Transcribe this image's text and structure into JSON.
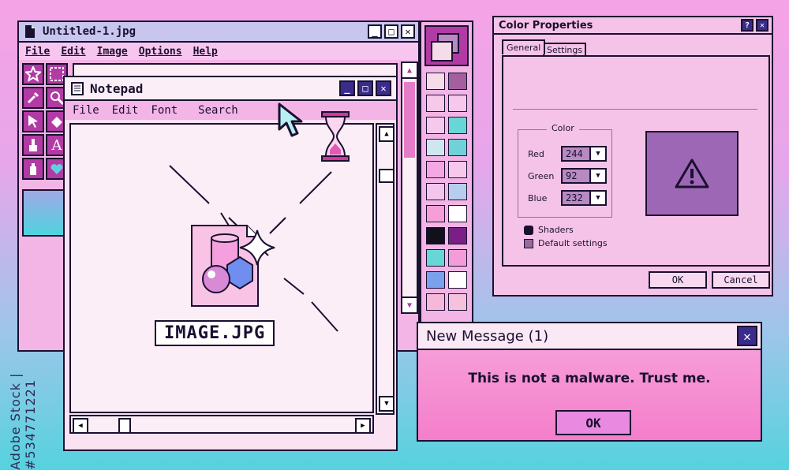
{
  "paint": {
    "title": "Untitled-1.jpg",
    "menu": [
      "File",
      "Edit",
      "Image",
      "Options",
      "Help"
    ]
  },
  "notepad": {
    "title": "Notepad",
    "menu": [
      "File",
      "Edit",
      "Font",
      "Search"
    ],
    "file_label": "IMAGE.JPG"
  },
  "color_properties": {
    "title": "Color Properties",
    "tabs": [
      "General",
      "Settings"
    ],
    "group_label": "Color",
    "red_label": "Red",
    "red_value": "244",
    "green_label": "Green",
    "green_value": "92",
    "blue_label": "Blue",
    "blue_value": "232",
    "check_shaders": "Shaders",
    "check_default": "Default settings",
    "ok": "OK",
    "cancel": "Cancel",
    "preview_color": "#9e67b5"
  },
  "message": {
    "title": "New Message (1)",
    "text": "This is not a malware. Trust me.",
    "ok": "OK"
  },
  "palette": [
    "#f6dbe8",
    "#a35fa0",
    "#f6c8ea",
    "#f5c8ec",
    "#f6c8ec",
    "#66d6d6",
    "#cfe6ef",
    "#6fd2d8",
    "#f4a7e2",
    "#f5c8ec",
    "#f3c5ec",
    "#b6cdee",
    "#f69ed7",
    "#ffffff",
    "#12101c",
    "#7b1e86",
    "#66d6d6",
    "#f49cd9",
    "#7aa2ec",
    "#ffffff",
    "#f6b8d8",
    "#f6c1dc"
  ],
  "watermark": "Adobe Stock | #534771221"
}
